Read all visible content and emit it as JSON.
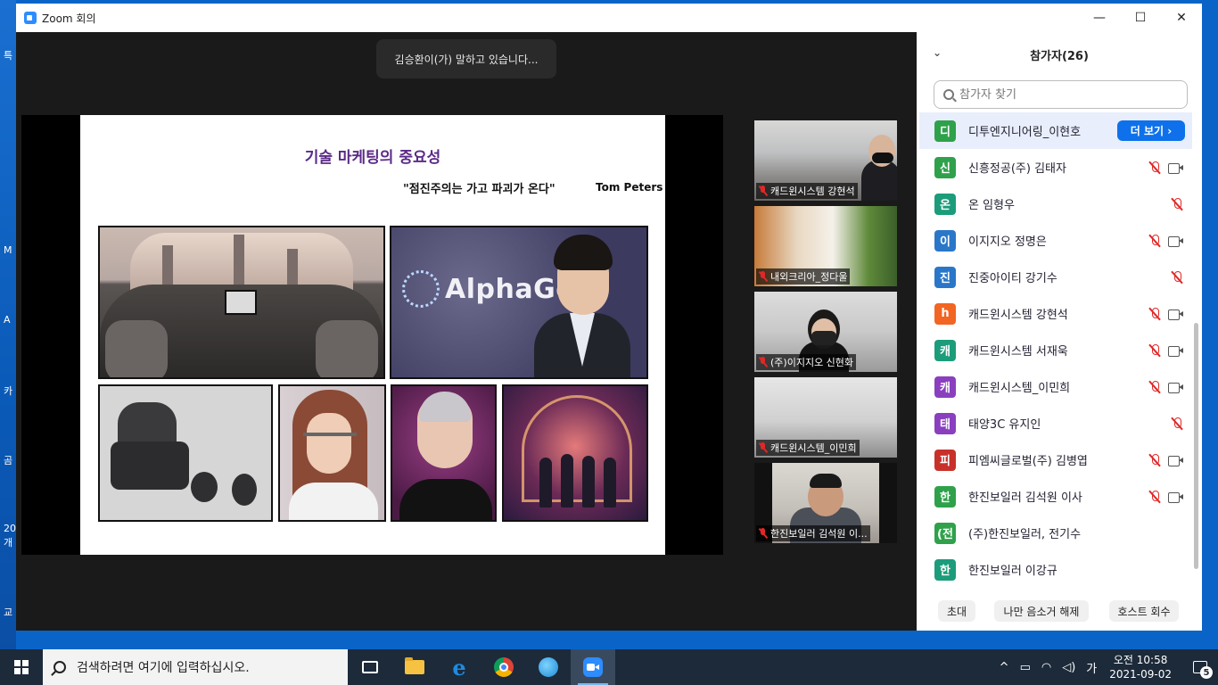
{
  "desktop": {
    "fragments": [
      "특",
      "M",
      "A",
      "카",
      "곰",
      "20",
      "개",
      "교"
    ]
  },
  "window": {
    "title": "Zoom 회의",
    "controls": {
      "minimize": "—",
      "maximize": "☐",
      "close": "✕"
    }
  },
  "speaker": {
    "tooltip": "김승환이(가) 말하고 있습니다..."
  },
  "slide": {
    "title": "기술 마케팅의 중요성",
    "quote": "\"점진주의는 가고 파괴가 온다\"",
    "author": "Tom Peters",
    "alphago_text": "AlphaGo"
  },
  "thumbnails": [
    {
      "label": "캐드윈시스템 강현석",
      "muted": true
    },
    {
      "label": "내외크리아_정다울",
      "muted": true
    },
    {
      "label": "(주)이지지오 신현화",
      "muted": true
    },
    {
      "label": "캐드윈시스템_이민희",
      "muted": true
    },
    {
      "label": "한진보일러 김석원 이...",
      "muted": true
    }
  ],
  "panel": {
    "title": "참가자(26)",
    "collapse_icon": "⌄",
    "search_placeholder": "참가자 찾기",
    "more_button": "더 보기 ›",
    "participants": [
      {
        "initial": "디",
        "name": "디투엔지니어링_이현호",
        "color": "#2fa14b",
        "muted": false,
        "video": false,
        "highlight": true
      },
      {
        "initial": "신",
        "name": "신흥정공(주) 김태자",
        "color": "#2fa14b",
        "muted": true,
        "video": true
      },
      {
        "initial": "온",
        "name": "온 임형우",
        "color": "#1c9c7a",
        "muted": true,
        "video": false
      },
      {
        "initial": "이",
        "name": "이지지오 정명은",
        "color": "#2a77c9",
        "muted": true,
        "video": true
      },
      {
        "initial": "진",
        "name": "진중아이티 강기수",
        "color": "#2a77c9",
        "muted": true,
        "video": false
      },
      {
        "initial": "h",
        "name": "캐드윈시스템 강현석",
        "color": "#f26522",
        "muted": true,
        "video": true
      },
      {
        "initial": "캐",
        "name": "캐드윈시스템 서재욱",
        "color": "#1c9c7a",
        "muted": true,
        "video": true
      },
      {
        "initial": "캐",
        "name": "캐드윈시스템_이민희",
        "color": "#8a3fbf",
        "muted": true,
        "video": true
      },
      {
        "initial": "태",
        "name": "태양3C 유지인",
        "color": "#8a3fbf",
        "muted": true,
        "video": false
      },
      {
        "initial": "피",
        "name": "피엠씨글로벌(주) 김병엽",
        "color": "#c8312a",
        "muted": true,
        "video": true
      },
      {
        "initial": "한",
        "name": "한진보일러 김석원 이사",
        "color": "#2fa14b",
        "muted": true,
        "video": true
      },
      {
        "initial": "(전",
        "name": "(주)한진보일러, 전기수",
        "color": "#2fa14b",
        "muted": false,
        "video": false
      },
      {
        "initial": "한",
        "name": "한진보일러 이강규",
        "color": "#1c9c7a",
        "muted": false,
        "video": false
      }
    ],
    "footer": {
      "invite": "초대",
      "unmute_me": "나만 음소거 해제",
      "reclaim_host": "호스트 회수"
    }
  },
  "taskbar": {
    "search_text": "검색하려면 여기에 입력하십시오.",
    "tray": {
      "chevron": "^",
      "ime": "가",
      "time": "오전 10:58",
      "date": "2021-09-02",
      "notifications": "5"
    }
  }
}
